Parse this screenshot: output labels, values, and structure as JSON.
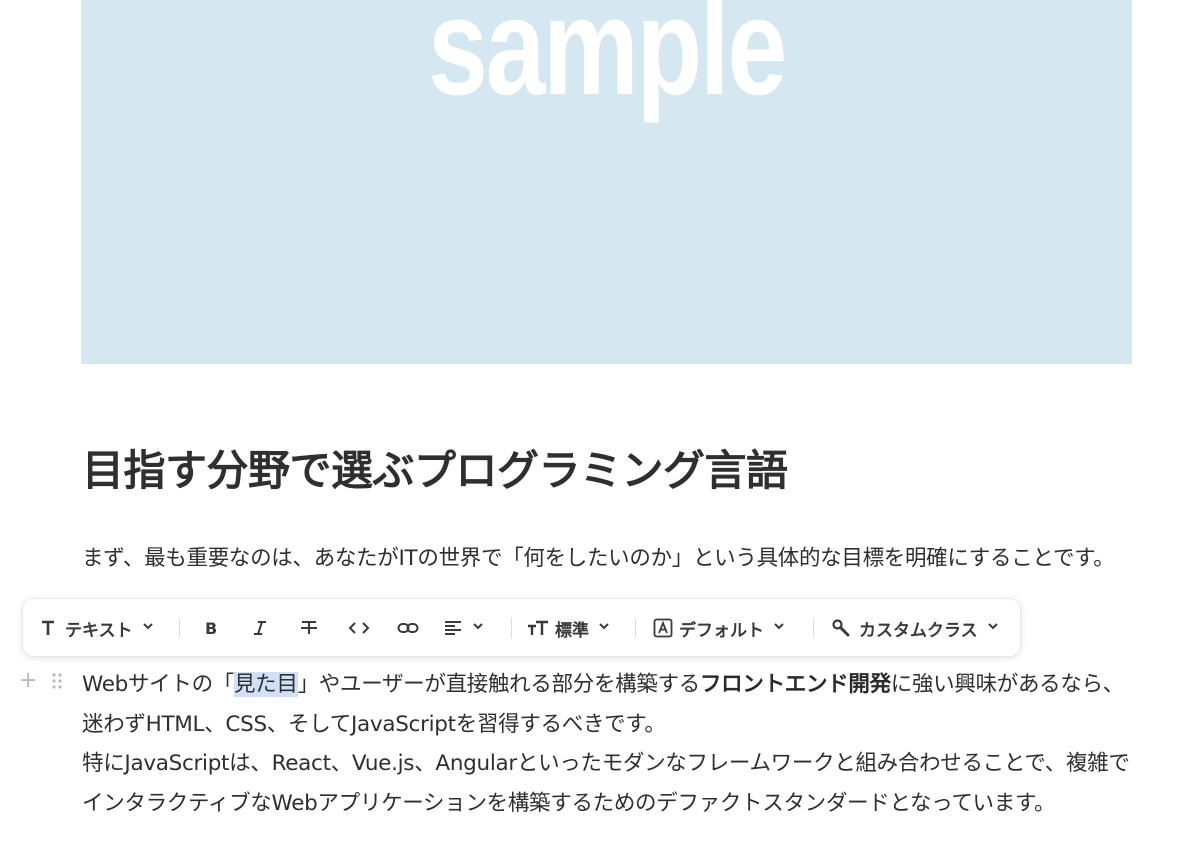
{
  "hero": {
    "word": "sample"
  },
  "heading": "目指す分野で選ぶプログラミング言語",
  "para1": {
    "text": "まず、最も重要なのは、あなたがITの世界で「何をしたいのか」という具体的な目標を明確にすることです。"
  },
  "toolbar": {
    "text_type": "テキスト",
    "size": "標準",
    "color": "デフォルト",
    "custom_class": "カスタムクラス",
    "icons": [
      "text-type-icon",
      "bold-icon",
      "italic-icon",
      "strikethrough-icon",
      "code-icon",
      "link-icon",
      "align-icon",
      "font-size-icon",
      "text-color-icon",
      "wrench-icon"
    ]
  },
  "para2": {
    "p1": "Webサイトの「",
    "selected": "見た目",
    "p2": "」やユーザーが直接触れる部分を構築する",
    "bold": "フロントエンド開発",
    "p3": "に強い興味があるなら、迷わずHTML、CSS、そしてJavaScriptを習得するべきです。",
    "p4": "特にJavaScriptは、React、Vue.js、Angularといったモダンなフレームワークと組み合わせることで、複雑でインタラクティブなWebアプリケーションを構築するためのデファクトスタンダードとなっています。"
  },
  "colors": {
    "hero_bg": "#d5e7f0",
    "selection": "#cfe0f7",
    "text": "#2f2f2f"
  }
}
